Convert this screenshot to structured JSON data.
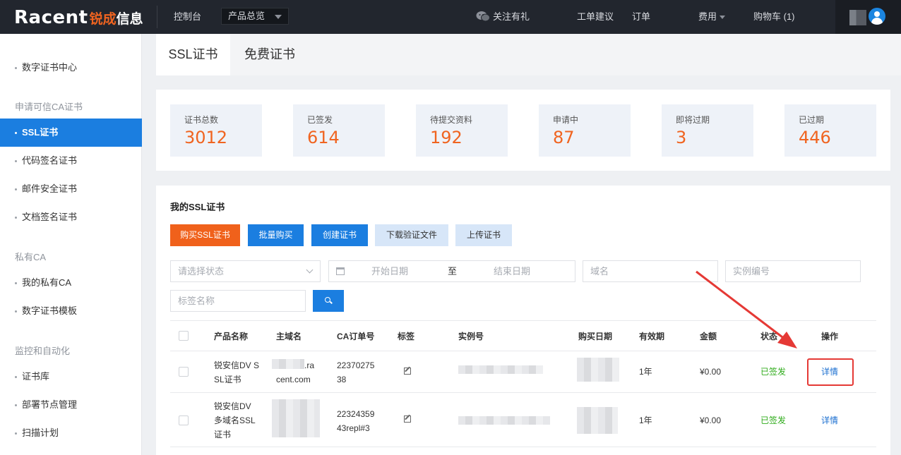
{
  "header": {
    "logo_en": "Racent",
    "logo_cn_a": "锐成",
    "logo_cn_b": "信息",
    "console": "控制台",
    "product_select": "产品总览",
    "follow": "关注有礼",
    "ticket": "工单建议",
    "order": "订单",
    "fee": "费用",
    "cart": "购物车 (1)"
  },
  "sidebar": {
    "cert_center": "数字证书中心",
    "group_ca": "申请可信CA证书",
    "ssl": "SSL证书",
    "code_sign": "代码签名证书",
    "email": "邮件安全证书",
    "doc_sign": "文档签名证书",
    "group_private": "私有CA",
    "my_ca": "我的私有CA",
    "template": "数字证书模板",
    "group_monitor": "监控和自动化",
    "library": "证书库",
    "deploy": "部署节点管理",
    "scan": "扫描计划"
  },
  "tabs": {
    "ssl": "SSL证书",
    "free": "免费证书"
  },
  "stats": [
    {
      "label": "证书总数",
      "value": "3012"
    },
    {
      "label": "已签发",
      "value": "614"
    },
    {
      "label": "待提交资料",
      "value": "192"
    },
    {
      "label": "申请中",
      "value": "87"
    },
    {
      "label": "即将过期",
      "value": "3"
    },
    {
      "label": "已过期",
      "value": "446"
    }
  ],
  "panel": {
    "title": "我的SSL证书",
    "btn_buy": "购买SSL证书",
    "btn_bulk": "批量购买",
    "btn_create": "创建证书",
    "btn_download": "下载验证文件",
    "btn_upload": "上传证书"
  },
  "filters": {
    "status": "请选择状态",
    "start": "开始日期",
    "to": "至",
    "end": "结束日期",
    "domain": "域名",
    "instance": "实例编号",
    "tag": "标签名称"
  },
  "table": {
    "headers": {
      "product": "产品名称",
      "domain": "主域名",
      "ca_order": "CA订单号",
      "tag": "标签",
      "instance": "实例号",
      "buy_date": "购买日期",
      "validity": "有效期",
      "amount": "金额",
      "status": "状态",
      "action": "操作"
    },
    "rows": [
      {
        "product_l1": "锐安信DV S",
        "product_l2": "SL证书",
        "domain_l1": ".ra",
        "domain_l2": "cent.com",
        "order_l1": "22370275",
        "order_l2": "38",
        "validity": "1年",
        "amount": "¥0.00",
        "status": "已签发",
        "action": "详情"
      },
      {
        "product_l1": "锐安信DV",
        "product_l2": "多域名SSL",
        "product_l3": "证书",
        "order_l1": "22324359",
        "order_l2": "43repl#3",
        "validity": "1年",
        "amount": "¥0.00",
        "status": "已签发",
        "action": "详情"
      }
    ]
  },
  "colors": {
    "accent_blue": "#1b7ee0",
    "accent_orange": "#f0611b",
    "success_green": "#2eab1a",
    "annotation_red": "#e53935"
  }
}
